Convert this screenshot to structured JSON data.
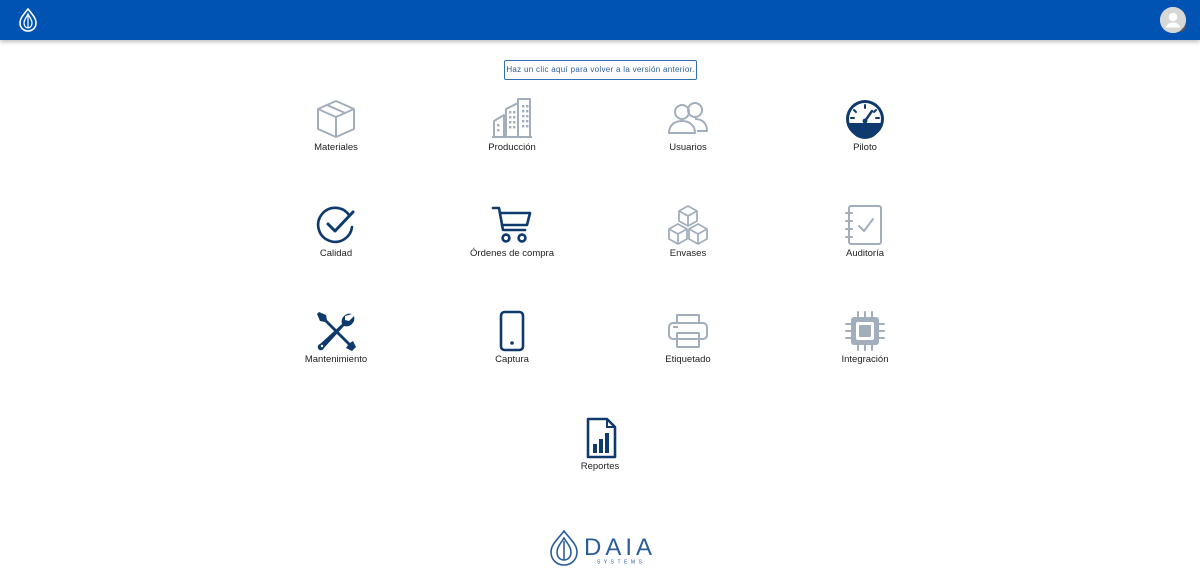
{
  "header": {
    "logo_icon": "daia-drop-logo-icon",
    "avatar_icon": "user-avatar-icon",
    "bar_color": "#0052b3"
  },
  "legacy_link": {
    "label": "Haz un clic aquí para volver a la versión anterior."
  },
  "modules": [
    {
      "label": "Materiales",
      "icon": "box-icon",
      "style": "light"
    },
    {
      "label": "Producción",
      "icon": "factory-icon",
      "style": "light"
    },
    {
      "label": "Usuarios",
      "icon": "users-icon",
      "style": "light"
    },
    {
      "label": "Piloto",
      "icon": "gauge-icon",
      "style": "dark"
    },
    {
      "label": "Calidad",
      "icon": "check-circle-icon",
      "style": "dark"
    },
    {
      "label": "Órdenes de compra",
      "icon": "shopping-cart-icon",
      "style": "dark"
    },
    {
      "label": "Envases",
      "icon": "cubes-icon",
      "style": "light"
    },
    {
      "label": "Auditoría",
      "icon": "checklist-notebook-icon",
      "style": "light"
    },
    {
      "label": "Mantenimiento",
      "icon": "tools-icon",
      "style": "dark"
    },
    {
      "label": "Captura",
      "icon": "mobile-phone-icon",
      "style": "dark"
    },
    {
      "label": "Etiquetado",
      "icon": "printer-icon",
      "style": "light"
    },
    {
      "label": "Integración",
      "icon": "chip-icon",
      "style": "light"
    },
    {
      "label": "Reportes",
      "icon": "report-chart-icon",
      "style": "dark"
    }
  ],
  "footer": {
    "brand_name": "DAIA",
    "brand_sub": "SYSTEMS"
  },
  "colors": {
    "icon_dark": "#0f3a6e",
    "icon_light": "#a3aebd",
    "link_border": "#2f6fb5"
  }
}
